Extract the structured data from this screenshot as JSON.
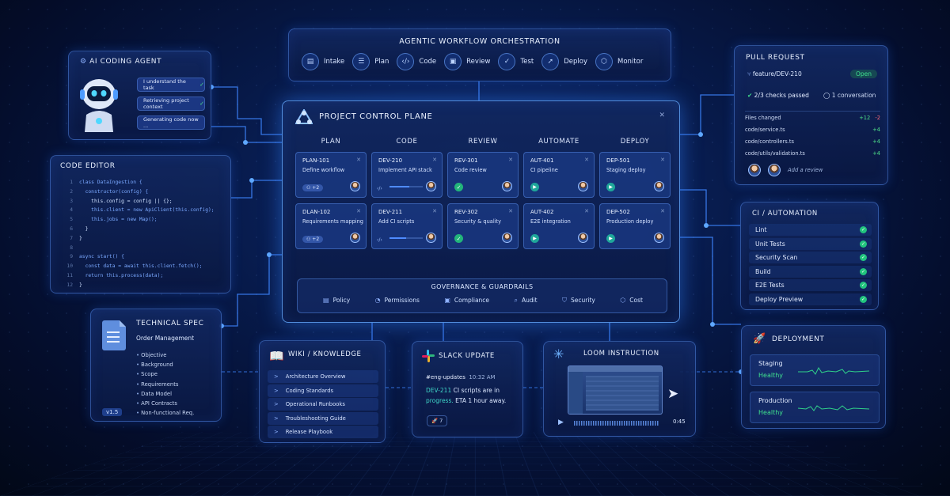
{
  "orchestration": {
    "title": "AGENTIC WORKFLOW ORCHESTRATION",
    "steps": [
      {
        "label": "Intake",
        "icon": "intake-icon"
      },
      {
        "label": "Plan",
        "icon": "plan-icon"
      },
      {
        "label": "Code",
        "icon": "code-icon"
      },
      {
        "label": "Review",
        "icon": "review-icon"
      },
      {
        "label": "Test",
        "icon": "test-icon"
      },
      {
        "label": "Deploy",
        "icon": "deploy-icon"
      },
      {
        "label": "Monitor",
        "icon": "monitor-icon"
      }
    ]
  },
  "agent": {
    "title": "AI CODING AGENT",
    "messages": [
      "I understand the task",
      "Retrieving project context",
      "Generating code now ..."
    ]
  },
  "editor": {
    "title": "CODE EDITOR",
    "lines": [
      {
        "n": "1",
        "text": "class DataIngestion {"
      },
      {
        "n": "2",
        "text": "  constructor(config) {"
      },
      {
        "n": "3",
        "text": "    this.config = config || {};"
      },
      {
        "n": "4",
        "text": "    this.client = new ApiClient(this.config);"
      },
      {
        "n": "5",
        "text": "    this.jobs = new Map();"
      },
      {
        "n": "6",
        "text": "  }"
      },
      {
        "n": "7",
        "text": "}"
      },
      {
        "n": "8",
        "text": ""
      },
      {
        "n": "9",
        "text": "async start() {"
      },
      {
        "n": "10",
        "text": "  const data = await this.client.fetch();"
      },
      {
        "n": "11",
        "text": "  return this.process(data);"
      },
      {
        "n": "12",
        "text": "}"
      }
    ]
  },
  "spec": {
    "title": "TECHNICAL SPEC",
    "subtitle": "Order Management",
    "items": [
      "Objective",
      "Background",
      "Scope",
      "Requirements",
      "Data Model",
      "API Contracts",
      "Non-functional Req."
    ],
    "version": "v1.5"
  },
  "control_plane": {
    "title": "PROJECT CONTROL PLANE",
    "columns": [
      "PLAN",
      "CODE",
      "REVIEW",
      "AUTOMATE",
      "DEPLOY"
    ],
    "cards": [
      {
        "id": "PLAN-101",
        "name": "Define workflow",
        "pill": "+2"
      },
      {
        "id": "DEV-210",
        "name": "Implement API stack",
        "progress": 0.6
      },
      {
        "id": "REV-301",
        "name": "Code review"
      },
      {
        "id": "AUT-401",
        "name": "CI pipeline"
      },
      {
        "id": "DEP-501",
        "name": "Staging deploy"
      },
      {
        "id": "DLAN-102",
        "name": "Requirements mapping",
        "pill": "+2"
      },
      {
        "id": "DEV-211",
        "name": "Add CI scripts",
        "progress": 0.5
      },
      {
        "id": "REV-302",
        "name": "Security & quality"
      },
      {
        "id": "AUT-402",
        "name": "E2E integration"
      },
      {
        "id": "DEP-502",
        "name": "Production deploy"
      }
    ],
    "governance": {
      "title": "GOVERNANCE & GUARDRAILS",
      "items": [
        "Policy",
        "Permissions",
        "Compliance",
        "Audit",
        "Security",
        "Cost"
      ]
    }
  },
  "wiki": {
    "title": "WIKI / KNOWLEDGE",
    "items": [
      "Architecture Overview",
      "Coding Standards",
      "Operational Runbooks",
      "Troubleshooting Guide",
      "Release Playbook"
    ]
  },
  "slack": {
    "title": "SLACK UPDATE",
    "channel": "#eng-updates",
    "time": "10:32 AM",
    "ticket": "DEV-211",
    "text_a": " CI scripts are in",
    "status": "progress.",
    "text_b": " ETA 1 hour away.",
    "reaction": "7"
  },
  "loom": {
    "title": "LOOM INSTRUCTION",
    "duration": "0:45"
  },
  "pr": {
    "title": "PULL REQUEST",
    "branch": "feature/DEV-210",
    "status": "Open",
    "checks": "2/3 checks passed",
    "conversation": "1 conversation",
    "files_label": "Files changed",
    "added": "+12",
    "removed": "-2",
    "files": [
      {
        "path": "code/service.ts",
        "delta": "+4"
      },
      {
        "path": "code/controllers.ts",
        "delta": "+4"
      },
      {
        "path": "code/utils/validation.ts",
        "delta": "+4"
      }
    ],
    "review_placeholder": "Add a review"
  },
  "ci": {
    "title": "CI / AUTOMATION",
    "items": [
      "Lint",
      "Unit Tests",
      "Security Scan",
      "Build",
      "E2E Tests",
      "Deploy Preview"
    ]
  },
  "deployment": {
    "title": "DEPLOYMENT",
    "envs": [
      {
        "name": "Staging",
        "status": "Healthy"
      },
      {
        "name": "Production",
        "status": "Healthy"
      }
    ]
  },
  "colors": {
    "accent": "#4f8bff",
    "success": "#3fe08e",
    "background": "#071a4a"
  }
}
